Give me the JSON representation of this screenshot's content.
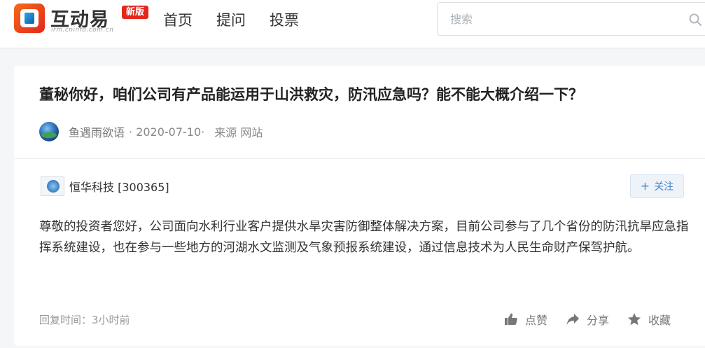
{
  "header": {
    "logo_title": "互动易",
    "logo_badge": "新版",
    "logo_sub": "irm.cninfo.com.cn",
    "nav": [
      "首页",
      "提问",
      "投票"
    ],
    "search_placeholder": "搜索"
  },
  "question": {
    "title": "董秘你好，咱们公司有产品能运用于山洪救灾，防汛应急吗？能不能大概介绍一下？",
    "author": "鱼遇雨欲语",
    "date": "· 2020-07-10·",
    "source": "来源 网站"
  },
  "answer": {
    "company": "恒华科技 [300365]",
    "follow_label": "关注",
    "follow_plus": "+",
    "text": "尊敬的投资者您好，公司面向水利行业客户提供水旱灾害防御整体解决方案，目前公司参与了几个省份的防汛抗旱应急指挥系统建设，也在参与一些地方的河湖水文监测及气象预报系统建设，通过信息技术为人民生命财产保驾护航。",
    "reply_time": "回复时间：3小时前",
    "actions": {
      "like": "点赞",
      "share": "分享",
      "favorite": "收藏"
    }
  },
  "colors": {
    "brand_red": "#e4261b",
    "follow_blue": "#4a86c8",
    "icon_gray": "#777777"
  },
  "icons": [
    "search-icon",
    "thumbs-up-icon",
    "share-arrow-icon",
    "star-icon"
  ]
}
